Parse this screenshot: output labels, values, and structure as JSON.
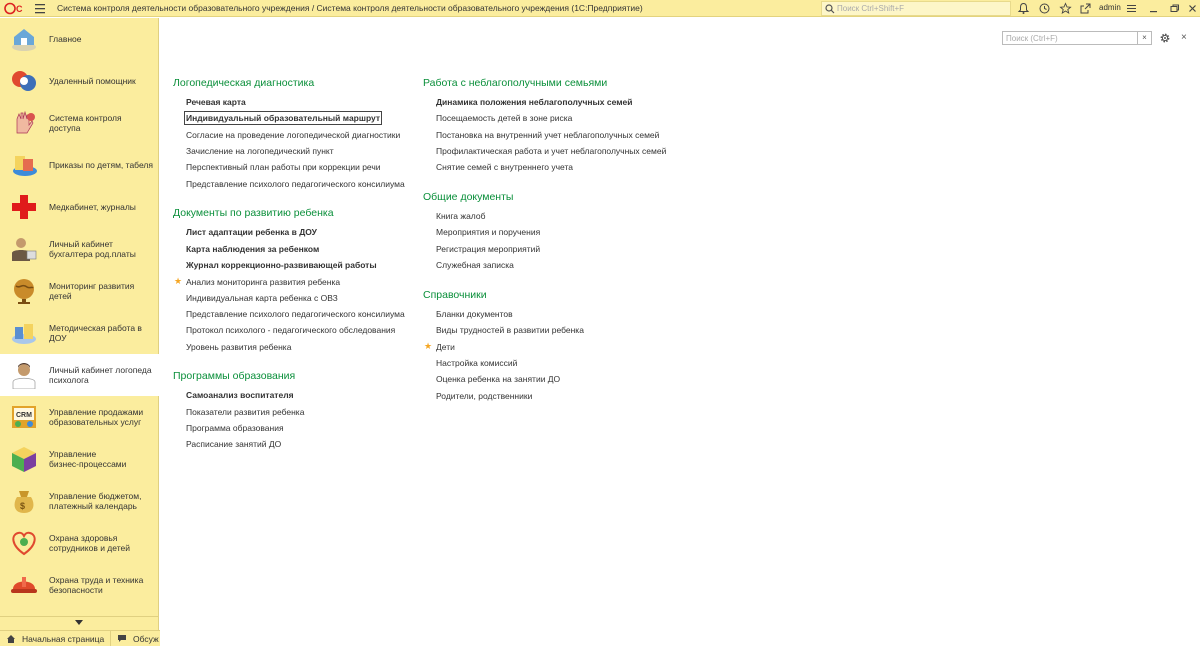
{
  "titlebar": {
    "logo_text": "1С",
    "title": "Система контроля деятельности образовательного учреждения / Система контроля деятельности образовательного учреждения  (1С:Предприятие)",
    "search_placeholder": "Поиск Ctrl+Shift+F",
    "user": "admin",
    "icons": [
      "notification-bell-icon",
      "history-icon",
      "favorites-star-icon",
      "links-icon",
      "user-menu-icon",
      "minimize-icon",
      "restore-icon",
      "close-icon"
    ]
  },
  "sidebar": {
    "items": [
      {
        "label": "Главное",
        "icon": "home-icon",
        "color": "#6aa7d8"
      },
      {
        "label": "Удаленный помощник",
        "icon": "remote-assistant-icon",
        "color": "#e0492f"
      },
      {
        "label": "Система контроля доступа",
        "icon": "access-control-icon",
        "color": "#d9534f"
      },
      {
        "label": "Приказы по детям, табеля",
        "icon": "orders-icon",
        "color": "#3d8bd9"
      },
      {
        "label": "Медкабинет, журналы",
        "icon": "medical-cross-icon",
        "color": "#e01b1b"
      },
      {
        "label": "Личный кабинет\nбухгалтера род.платы",
        "icon": "accountant-icon",
        "color": "#8a6d3b"
      },
      {
        "label": "Мониторинг развития\nдетей",
        "icon": "globe-icon",
        "color": "#c98b2a"
      },
      {
        "label": "Методическая работа в\nДОУ",
        "icon": "methodical-icon",
        "color": "#5a8fd0"
      },
      {
        "label": "Личный кабинет логопеда\nпсихолога",
        "icon": "speech-therapist-icon",
        "color": "#c49a6c"
      },
      {
        "label": "Управление продажами\nобразовательных услуг",
        "icon": "crm-icon",
        "color": "#e2a32a"
      },
      {
        "label": "Управление\nбизнес-процессами",
        "icon": "business-process-cube-icon",
        "color": "#4caf50"
      },
      {
        "label": "Управление бюджетом,\nплатежный календарь",
        "icon": "budget-icon",
        "color": "#e0b64b"
      },
      {
        "label": "Охрана здоровья\nсотрудников и детей",
        "icon": "health-heart-icon",
        "color": "#e0492f"
      },
      {
        "label": "Охрана труда и техника\nбезопасности",
        "icon": "safety-helmet-icon",
        "color": "#e04a2a"
      }
    ],
    "active_index": 8,
    "scroll_down_icon": "chevron-down-icon"
  },
  "bottombar": {
    "tabs": [
      {
        "label": "Начальная страница",
        "icon": "home-icon"
      },
      {
        "label": "Обсуж",
        "icon": "chat-icon"
      }
    ]
  },
  "panel": {
    "search_placeholder": "Поиск (Ctrl+F)",
    "clear_symbol": "×",
    "close_symbol": "×"
  },
  "sections": {
    "speech": {
      "title": "Логопедическая диагностика",
      "links": [
        "Речевая карта",
        "Индивидуальный образовательный маршрут",
        "Согласие на проведение логопедической диагностики",
        "Зачисление на логопедический пункт",
        "Перспективный план работы при коррекции речи",
        "Представление психолого педагогического консилиума"
      ]
    },
    "development": {
      "title": "Документы по развитию ребенка",
      "links": [
        "Лист адаптации ребенка в ДОУ",
        "Карта наблюдения за ребенком",
        "Журнал коррекционно-развивающей работы",
        "Анализ мониторинга развития ребенка",
        "Индивидуальная карта ребенка с ОВЗ",
        "Представление психолого педагогического консилиума",
        "Протокол психолого - педагогического обследования",
        "Уровень развития ребенка"
      ]
    },
    "programs": {
      "title": "Программы образования",
      "links": [
        "Самоанализ воспитателя",
        "Показатели развития ребенка",
        "Программа образования",
        "Расписание занятий ДО"
      ]
    },
    "families": {
      "title": "Работа с неблагополучными семьями",
      "links": [
        "Динамика положения неблагополучных семей",
        "Посещаемость детей в зоне риска",
        "Постановка на внутренний учет неблагополучных семей",
        "Профилактическая работа и учет неблагополучных семей",
        "Снятие семей с внутреннего учета"
      ]
    },
    "general": {
      "title": "Общие документы",
      "links": [
        "Книга жалоб",
        "Мероприятия и поручения",
        "Регистрация мероприятий",
        "Служебная записка"
      ]
    },
    "reference": {
      "title": "Справочники",
      "links": [
        "Бланки документов",
        "Виды трудностей в развитии ребенка",
        "Дети",
        "Настройка комиссий",
        "Оценка ребенка на занятии ДО",
        "Родители, родственники"
      ]
    }
  },
  "colors": {
    "accent_yellow": "#fbed9e",
    "section_green": "#0a8f3a",
    "star_orange": "#f5a623"
  }
}
